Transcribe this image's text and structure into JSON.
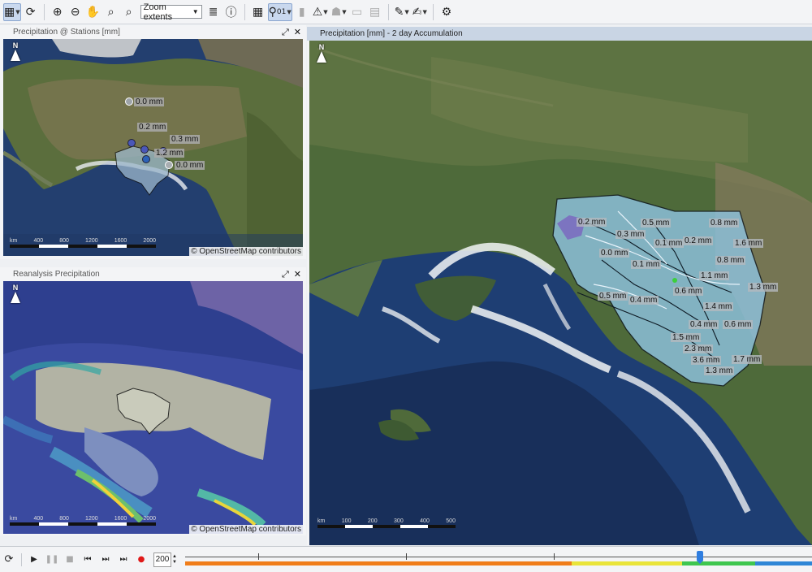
{
  "toolbar": {
    "zoom_select_value": "Zoom extents",
    "layer_badge": "01",
    "icons": [
      "select-rect-icon",
      "refresh-icon",
      "zoom-in-icon",
      "zoom-out-icon",
      "pan-hand-icon",
      "zoom-box-in-icon",
      "zoom-box-out-icon",
      "layers-icon",
      "info-icon",
      "grid-table-icon",
      "location-pin-icon",
      "ruler-icon",
      "warning-icon",
      "stamp-icon",
      "export-icon",
      "grid-icon",
      "pencil-icon",
      "edit-icon",
      "settings-gear-icon"
    ]
  },
  "panels": {
    "stations": {
      "title": "Precipitation @ Stations [mm]",
      "attribution": "© OpenStreetMap contributors",
      "north": "N",
      "scale_labels": [
        "km",
        "400",
        "800",
        "1200",
        "1600",
        "2000"
      ],
      "station_labels": [
        "0.0 mm",
        "0.2 mm",
        "0.3 mm",
        "1.2 mm",
        "0.0 mm"
      ]
    },
    "reanalysis": {
      "title": "Reanalysis Precipitation",
      "attribution": "© OpenStreetMap contributors",
      "north": "N",
      "scale_labels": [
        "km",
        "400",
        "800",
        "1200",
        "1600",
        "2000"
      ]
    },
    "accumulation": {
      "title": "Precipitation [mm] - 2 day Accumulation",
      "north": "N",
      "scale_labels": [
        "km",
        "100",
        "200",
        "300",
        "400",
        "500"
      ],
      "basin_labels": [
        "0.2 mm",
        "0.5 mm",
        "0.8 mm",
        "0.3 mm",
        "0.1 mm",
        "0.2 mm",
        "1.6 mm",
        "0.0 mm",
        "0.8 mm",
        "0.1 mm",
        "1.1 mm",
        "1.3 mm",
        "0.6 mm",
        "0.5 mm",
        "0.4 mm",
        "1.4 mm",
        "0.4 mm",
        "0.6 mm",
        "1.5 mm",
        "2.3 mm",
        "3.6 mm",
        "1.7 mm",
        "1.3 mm"
      ]
    }
  },
  "timeline": {
    "speed": "200",
    "progress_fraction": 0.821,
    "colors": {
      "orange": "#f07d1a",
      "yellow": "#e9e43a",
      "green": "#3ec64f",
      "blue": "#2f86d6",
      "thumb": "#2f7de0"
    }
  }
}
